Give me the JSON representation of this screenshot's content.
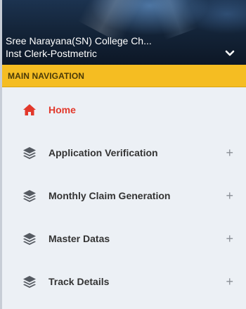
{
  "user_panel": {
    "name": "Sree Narayana(SN) College Ch...",
    "role": "Inst Clerk-Postmetric",
    "toggle_icon": "chevron-down-icon"
  },
  "nav": {
    "header": "MAIN NAVIGATION",
    "items": [
      {
        "label": "Home",
        "icon": "home-icon",
        "active": true,
        "expandable": false
      },
      {
        "label": "Application Verification",
        "icon": "layers-icon",
        "active": false,
        "expandable": true,
        "expand_glyph": "+"
      },
      {
        "label": "Monthly Claim Generation",
        "icon": "layers-icon",
        "active": false,
        "expandable": true,
        "expand_glyph": "+"
      },
      {
        "label": "Master Datas",
        "icon": "layers-icon",
        "active": false,
        "expandable": true,
        "expand_glyph": "+"
      },
      {
        "label": "Track Details",
        "icon": "layers-icon",
        "active": false,
        "expandable": true,
        "expand_glyph": "+"
      }
    ]
  },
  "colors": {
    "header_bg": "#f5bd22",
    "active_text": "#e2382b",
    "sidebar_bg": "#ecf0f5"
  }
}
